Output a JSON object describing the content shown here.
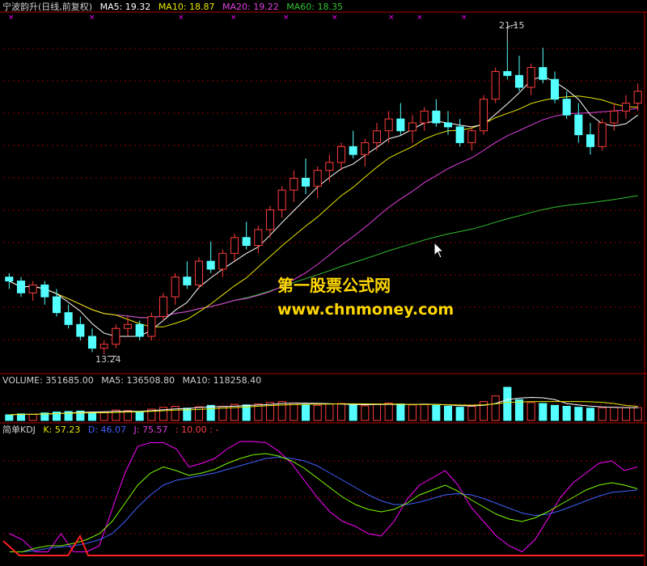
{
  "header": {
    "title": "宁波韵升(日线,前复权)",
    "ma5": "MA5: 19.32",
    "ma10": "MA10: 18.87",
    "ma20": "MA20: 19.22",
    "ma60": "MA60: 18.35"
  },
  "price_labels": {
    "high": "21.15",
    "low": "13.24"
  },
  "volume": {
    "title": "VOLUME: 351685.00",
    "ma5": "MA5: 136508.80",
    "ma10": "MA10: 118258.40"
  },
  "kdj": {
    "title": "简单KDJ",
    "k": "K: 57.23",
    "d": "D: 46.07",
    "j": "J: 75.57",
    "extra": ": 10.00 : -"
  },
  "watermark": {
    "line1": "第一股票公式网",
    "line2": "www.chnmoney.com"
  },
  "colors": {
    "up": "#ff3b3b",
    "down": "#54ffff",
    "ma5": "#ffffff",
    "ma10": "#e6e600",
    "ma20": "#e040e0",
    "ma60": "#30c030",
    "k": "#ffffff",
    "d": "#ffff00",
    "j": "#ff00ff",
    "grid": "#8b0000",
    "watermark": "#ffd700"
  },
  "chart_data": {
    "type": "candlestick",
    "price_range": [
      12.8,
      21.8
    ],
    "high": 21.15,
    "low": 13.24,
    "candles": [
      [
        15.2,
        15.3,
        14.9,
        15.1
      ],
      [
        15.1,
        15.2,
        14.7,
        14.8
      ],
      [
        14.8,
        15.1,
        14.6,
        15.0
      ],
      [
        15.0,
        15.1,
        14.5,
        14.7
      ],
      [
        14.7,
        14.9,
        14.2,
        14.3
      ],
      [
        14.3,
        14.5,
        13.9,
        14.0
      ],
      [
        14.0,
        14.2,
        13.6,
        13.7
      ],
      [
        13.7,
        13.9,
        13.3,
        13.4
      ],
      [
        13.4,
        13.6,
        13.24,
        13.5
      ],
      [
        13.5,
        14.0,
        13.4,
        13.9
      ],
      [
        13.9,
        14.2,
        13.7,
        14.0
      ],
      [
        14.0,
        14.1,
        13.6,
        13.7
      ],
      [
        13.7,
        14.3,
        13.6,
        14.2
      ],
      [
        14.2,
        14.8,
        14.1,
        14.7
      ],
      [
        14.7,
        15.3,
        14.5,
        15.2
      ],
      [
        15.2,
        15.6,
        14.9,
        15.0
      ],
      [
        15.0,
        15.7,
        14.9,
        15.6
      ],
      [
        15.6,
        16.1,
        15.3,
        15.4
      ],
      [
        15.4,
        15.9,
        15.2,
        15.8
      ],
      [
        15.8,
        16.3,
        15.6,
        16.2
      ],
      [
        16.2,
        16.6,
        15.9,
        16.0
      ],
      [
        16.0,
        16.5,
        15.8,
        16.4
      ],
      [
        16.4,
        17.0,
        16.2,
        16.9
      ],
      [
        16.9,
        17.5,
        16.7,
        17.4
      ],
      [
        17.4,
        17.9,
        17.1,
        17.7
      ],
      [
        17.7,
        18.2,
        17.3,
        17.5
      ],
      [
        17.5,
        18.0,
        17.2,
        17.9
      ],
      [
        17.9,
        18.3,
        17.6,
        18.1
      ],
      [
        18.1,
        18.6,
        17.9,
        18.5
      ],
      [
        18.5,
        18.9,
        18.2,
        18.3
      ],
      [
        18.3,
        18.7,
        18.0,
        18.6
      ],
      [
        18.6,
        19.1,
        18.4,
        18.9
      ],
      [
        18.9,
        19.4,
        18.6,
        19.2
      ],
      [
        19.2,
        19.6,
        18.8,
        18.9
      ],
      [
        18.9,
        19.3,
        18.6,
        19.1
      ],
      [
        19.1,
        19.5,
        18.9,
        19.4
      ],
      [
        19.4,
        19.7,
        19.0,
        19.1
      ],
      [
        19.1,
        19.4,
        18.8,
        19.0
      ],
      [
        19.0,
        19.2,
        18.5,
        18.6
      ],
      [
        18.6,
        19.0,
        18.4,
        18.9
      ],
      [
        18.9,
        19.8,
        18.8,
        19.7
      ],
      [
        19.7,
        20.5,
        19.6,
        20.4
      ],
      [
        20.4,
        21.15,
        20.2,
        20.3
      ],
      [
        20.3,
        20.8,
        19.9,
        20.0
      ],
      [
        20.0,
        20.6,
        19.8,
        20.5
      ],
      [
        20.5,
        21.0,
        20.1,
        20.2
      ],
      [
        20.2,
        20.4,
        19.6,
        19.7
      ],
      [
        19.7,
        19.9,
        19.2,
        19.3
      ],
      [
        19.3,
        19.6,
        18.6,
        18.8
      ],
      [
        18.8,
        19.1,
        18.3,
        18.5
      ],
      [
        18.5,
        19.2,
        18.4,
        19.1
      ],
      [
        19.1,
        19.6,
        18.9,
        19.4
      ],
      [
        19.4,
        19.8,
        19.2,
        19.6
      ],
      [
        19.6,
        20.1,
        19.4,
        19.9
      ]
    ],
    "volume_range": [
      0,
      360000
    ],
    "volumes": [
      60000,
      70000,
      65000,
      80000,
      90000,
      95000,
      100000,
      85000,
      90000,
      110000,
      105000,
      95000,
      120000,
      140000,
      150000,
      130000,
      145000,
      160000,
      150000,
      170000,
      165000,
      175000,
      190000,
      200000,
      185000,
      170000,
      160000,
      175000,
      180000,
      165000,
      155000,
      170000,
      185000,
      175000,
      165000,
      170000,
      160000,
      150000,
      140000,
      150000,
      200000,
      260000,
      351685,
      220000,
      190000,
      180000,
      160000,
      150000,
      140000,
      130000,
      135000,
      140000,
      138000,
      136000
    ],
    "kdj_range": [
      0,
      100
    ],
    "k": [
      5,
      5,
      8,
      10,
      10,
      12,
      15,
      20,
      30,
      45,
      60,
      70,
      75,
      72,
      68,
      70,
      73,
      78,
      82,
      85,
      86,
      84,
      80,
      74,
      66,
      58,
      50,
      44,
      40,
      38,
      40,
      45,
      52,
      56,
      60,
      55,
      48,
      42,
      36,
      32,
      30,
      33,
      38,
      44,
      50,
      56,
      60,
      62,
      60,
      57
    ],
    "d": [
      5,
      5,
      6,
      8,
      9,
      10,
      12,
      15,
      20,
      30,
      42,
      52,
      60,
      64,
      66,
      68,
      70,
      73,
      76,
      79,
      82,
      83,
      82,
      80,
      76,
      70,
      64,
      58,
      52,
      47,
      44,
      44,
      46,
      49,
      52,
      53,
      52,
      49,
      45,
      41,
      37,
      35,
      36,
      39,
      43,
      47,
      51,
      54,
      55,
      56
    ],
    "j": [
      20,
      15,
      5,
      5,
      20,
      5,
      5,
      10,
      40,
      70,
      92,
      95,
      95,
      90,
      75,
      78,
      82,
      90,
      96,
      96,
      95,
      88,
      78,
      64,
      50,
      38,
      30,
      26,
      20,
      18,
      30,
      48,
      60,
      66,
      72,
      60,
      42,
      30,
      18,
      10,
      5,
      15,
      32,
      50,
      62,
      70,
      78,
      80,
      72,
      75
    ]
  }
}
